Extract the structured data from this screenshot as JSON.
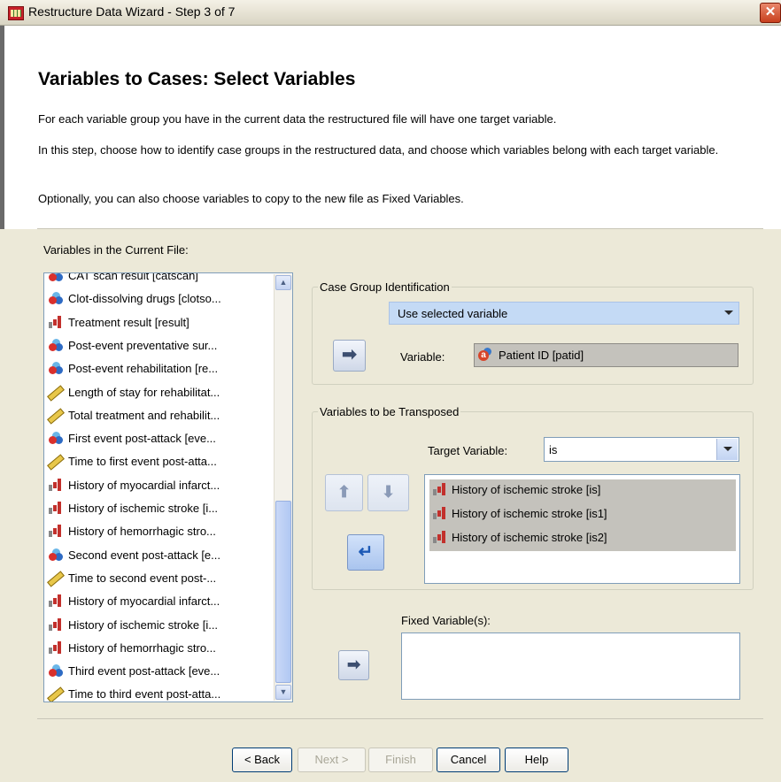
{
  "window": {
    "title": "Restructure Data Wizard - Step 3 of 7",
    "close_glyph": "✕"
  },
  "header": {
    "title": "Variables to Cases: Select Variables",
    "p1": "For each variable group you have in the current data the restructured file will have one target variable.",
    "p2": "In this step, choose how to identify case groups in the restructured data, and choose which variables belong with each target variable.",
    "p3": "Optionally, you can also choose variables to copy to the new file as Fixed Variables."
  },
  "current_file": {
    "label": "Variables in the Current File:",
    "items": [
      {
        "label": "CAT scan result [catscan]",
        "icon": "nominal-icon"
      },
      {
        "label": "Clot-dissolving drugs [clotso...",
        "icon": "nominal-icon"
      },
      {
        "label": "Treatment result [result]",
        "icon": "ordinal-icon"
      },
      {
        "label": "Post-event preventative sur...",
        "icon": "nominal-icon"
      },
      {
        "label": "Post-event rehabilitation [re...",
        "icon": "nominal-icon"
      },
      {
        "label": "Length of stay for rehabilitat...",
        "icon": "scale-icon"
      },
      {
        "label": "Total treatment and rehabilit...",
        "icon": "scale-icon"
      },
      {
        "label": "First event post-attack [eve...",
        "icon": "nominal-icon"
      },
      {
        "label": "Time to first event post-atta...",
        "icon": "scale-icon"
      },
      {
        "label": "History of myocardial infarct...",
        "icon": "ordinal-icon"
      },
      {
        "label": "History of ischemic stroke [i...",
        "icon": "ordinal-icon"
      },
      {
        "label": "History of hemorrhagic stro...",
        "icon": "ordinal-icon"
      },
      {
        "label": "Second event post-attack [e...",
        "icon": "nominal-icon"
      },
      {
        "label": "Time to second event post-...",
        "icon": "scale-icon"
      },
      {
        "label": "History of myocardial infarct...",
        "icon": "ordinal-icon"
      },
      {
        "label": "History of ischemic stroke [i...",
        "icon": "ordinal-icon"
      },
      {
        "label": "History of hemorrhagic stro...",
        "icon": "ordinal-icon"
      },
      {
        "label": "Third event post-attack [eve...",
        "icon": "nominal-icon"
      },
      {
        "label": "Time to third event post-atta...",
        "icon": "scale-icon"
      }
    ]
  },
  "case_group": {
    "legend": "Case Group Identification",
    "method": "Use selected variable",
    "variable_label": "Variable:",
    "variable_value": "Patient ID [patid]"
  },
  "transpose": {
    "legend": "Variables to be Transposed",
    "target_label": "Target Variable:",
    "target_value": "is",
    "items": [
      "History of ischemic stroke [is]",
      "History of ischemic stroke [is1]",
      "History of ischemic stroke [is2]"
    ]
  },
  "fixed": {
    "label": "Fixed Variable(s):"
  },
  "arrows": {
    "right": "➡",
    "up": "⬆",
    "down": "⬇",
    "left_return": "↵"
  },
  "buttons": {
    "back": "< Back",
    "next": "Next >",
    "finish": "Finish",
    "cancel": "Cancel",
    "help": "Help"
  },
  "colors": {
    "selection": "#c4c2bc",
    "focus_accent": "#316ac5",
    "title_bar": "#d9d5c3"
  }
}
